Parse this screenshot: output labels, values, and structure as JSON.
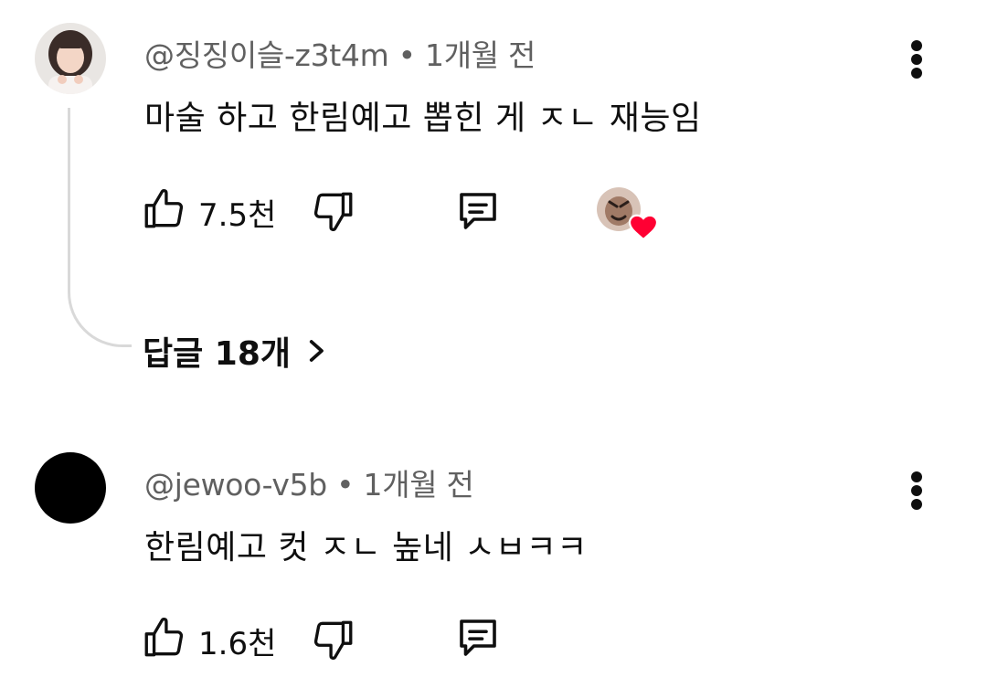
{
  "comments": [
    {
      "author": "@징징이슬-z3t4m",
      "time": "1개월 전",
      "text": "마술 하고 한림예고 뽑힌 게 ㅈㄴ 재능임",
      "likes": "7.5천",
      "replies_label": "답글 18개",
      "avatar": "profile-photo",
      "creator_heart": true
    },
    {
      "author": "@jewoo-v5b",
      "time": "1개월 전",
      "text": "한림예고 컷 ㅈㄴ 높네 ㅅㅂㅋㅋ",
      "likes": "1.6천",
      "avatar": "black-circle"
    }
  ],
  "icons": {
    "like": "thumbs-up-icon",
    "dislike": "thumbs-down-icon",
    "reply": "reply-comment-icon",
    "more": "more-vertical-icon",
    "chevron": "chevron-right-icon",
    "heart": "heart-icon"
  },
  "colors": {
    "heart": "#ff0033",
    "meta": "#606060",
    "text": "#0f0f0f"
  }
}
